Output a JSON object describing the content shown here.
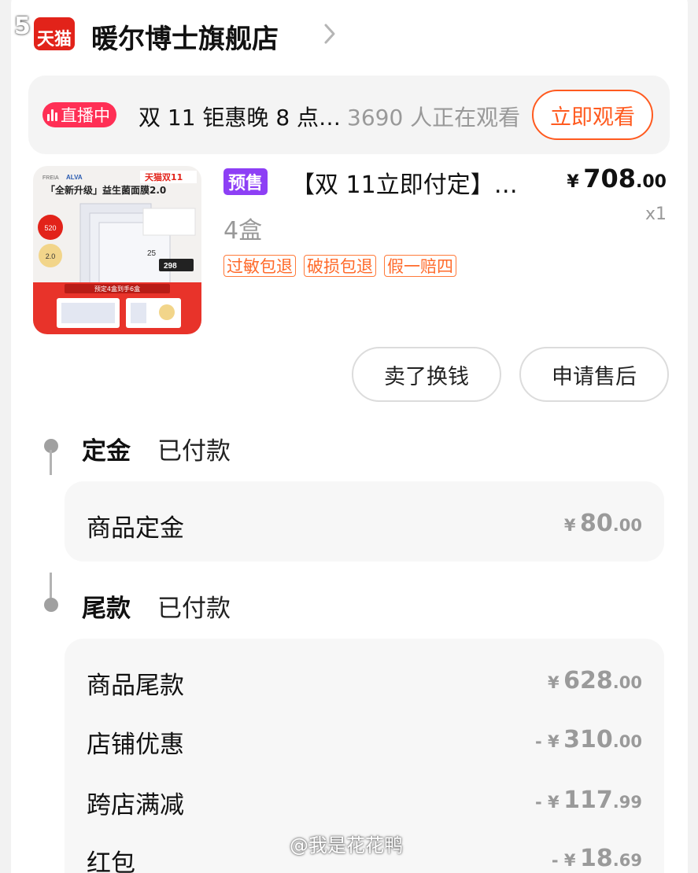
{
  "watermark_top": "5",
  "shop": {
    "logo_text": "天猫",
    "name": "暖尔博士旗舰店"
  },
  "live": {
    "badge": "直播中",
    "title": "双 11 钜惠晚 8 点…",
    "viewers": "3690 人正在观看",
    "watch_button": "立即观看"
  },
  "product": {
    "presale_tag": "预售",
    "title": "【双 11立即付定】…",
    "price": {
      "symbol": "¥",
      "integer": "708",
      "decimal": ".00"
    },
    "quantity": "x1",
    "variant": "4盒",
    "tags": [
      "过敏包退",
      "破损包退",
      "假一赔四"
    ],
    "image": {
      "brand_a": "FREIA",
      "brand_b": "ALVA",
      "tmall_badge": "天猫双11",
      "headline": "「全新升级」益生菌面膜2.0",
      "badge_top": "520",
      "badge_mid": "2.0",
      "price_tag": "298",
      "year": "25",
      "promo_text": "预定4盒到手6盒"
    }
  },
  "actions": {
    "sell": "卖了换钱",
    "after_sale": "申请售后"
  },
  "deposit": {
    "title": "定金",
    "status": "已付款",
    "rows": [
      {
        "label": "商品定金",
        "prefix": "",
        "symbol": "¥",
        "integer": "80",
        "decimal": ".00"
      }
    ]
  },
  "balance": {
    "title": "尾款",
    "status": "已付款",
    "rows": [
      {
        "label": "商品尾款",
        "prefix": "",
        "symbol": "¥",
        "integer": "628",
        "decimal": ".00"
      },
      {
        "label": "店铺优惠",
        "prefix": "- ",
        "symbol": "¥",
        "integer": "310",
        "decimal": ".00"
      },
      {
        "label": "跨店满减",
        "prefix": "- ",
        "symbol": "¥",
        "integer": "117",
        "decimal": ".99"
      },
      {
        "label": "红包",
        "prefix": "- ",
        "symbol": "¥",
        "integer": "18",
        "decimal": ".69"
      }
    ]
  },
  "watermark_bottom": "@我是花花鸭",
  "colors": {
    "accent": "#ff5a1f",
    "live_badge": "#ff2f55",
    "presale": "#8d3ff5",
    "tmall": "#e2231a"
  }
}
